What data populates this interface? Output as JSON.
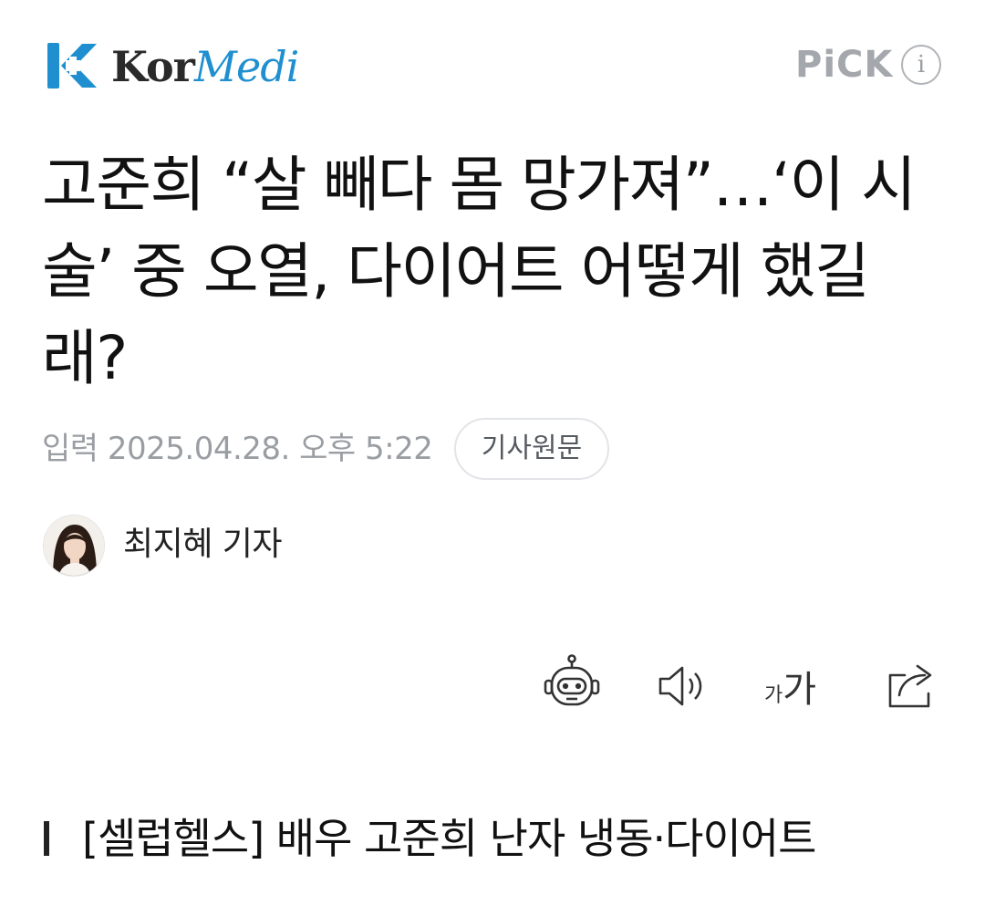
{
  "header": {
    "logo_kor": "Kor",
    "logo_medi": "Medi",
    "pick_label": "PiCK",
    "info_glyph": "i"
  },
  "article": {
    "headline": "고준희 “살 빼다 몸 망가져”…‘이 시술’ 중 오열, 다이어트 어떻게 했길래?",
    "published": "입력 2025.04.28. 오후 5:22",
    "original_button": "기사원문",
    "reporter": "최지혜 기자",
    "subheading": "[셀럽헬스] 배우 고준희 난자 냉동·다이어트"
  },
  "toolbar": {
    "font_small": "가",
    "font_big": "가"
  },
  "icons": [
    "kormedi-logo-icon",
    "info-icon",
    "summary-bot-icon",
    "speaker-icon",
    "font-size-icon",
    "share-icon"
  ],
  "colors": {
    "brand_blue": "#1f8fd0",
    "brand_dark": "#2a2a2a",
    "pick_gray": "#a4a8ad",
    "meta_gray": "#9a9ea3",
    "text": "#111111"
  }
}
